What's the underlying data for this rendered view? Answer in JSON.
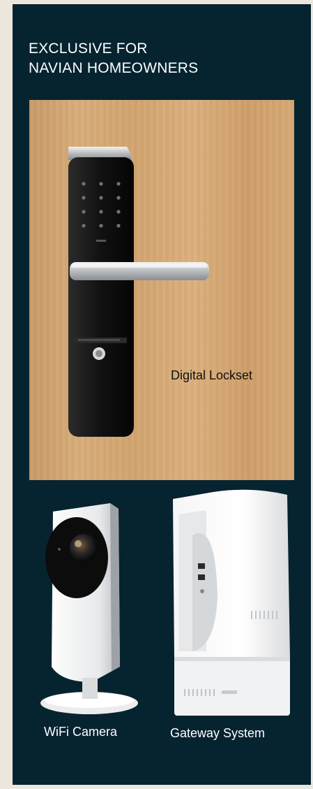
{
  "heading": {
    "line1": "EXCLUSIVE FOR",
    "line2": "NAVIAN HOMEOWNERS"
  },
  "products": {
    "lockset": {
      "label": "Digital Lockset",
      "icon": "digital-lockset-image"
    },
    "camera": {
      "label": "WiFi Camera",
      "icon": "wifi-camera-image"
    },
    "gateway": {
      "label": "Gateway System",
      "icon": "gateway-system-image"
    }
  },
  "colors": {
    "page_background": "#ece6dc",
    "panel_background": "#062330",
    "heading_text": "#ffffff",
    "wood_panel": "#d2a470"
  }
}
